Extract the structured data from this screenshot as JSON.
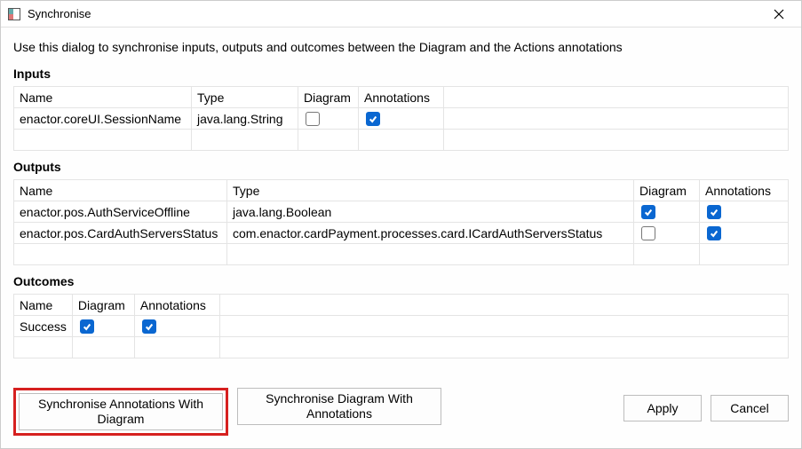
{
  "titlebar": {
    "title": "Synchronise"
  },
  "instructions": "Use this dialog to synchronise inputs, outputs and outcomes between the Diagram and the Actions annotations",
  "sections": {
    "inputs": "Inputs",
    "outputs": "Outputs",
    "outcomes": "Outcomes"
  },
  "headers": {
    "name": "Name",
    "type": "Type",
    "diagram": "Diagram",
    "annotations": "Annotations"
  },
  "inputs": {
    "rows": [
      {
        "name": "enactor.coreUI.SessionName",
        "type": "java.lang.String",
        "diagram": false,
        "annotations": true
      }
    ]
  },
  "outputs": {
    "rows": [
      {
        "name": "enactor.pos.AuthServiceOffline",
        "type": "java.lang.Boolean",
        "diagram": true,
        "annotations": true
      },
      {
        "name": "enactor.pos.CardAuthServersStatus",
        "type": "com.enactor.cardPayment.processes.card.ICardAuthServersStatus",
        "diagram": false,
        "annotations": true
      }
    ]
  },
  "outcomes": {
    "rows": [
      {
        "name": "Success",
        "diagram": true,
        "annotations": true
      }
    ]
  },
  "buttons": {
    "syncAnnotations": "Synchronise Annotations With Diagram",
    "syncDiagram": "Synchronise Diagram With Annotations",
    "apply": "Apply",
    "cancel": "Cancel"
  }
}
